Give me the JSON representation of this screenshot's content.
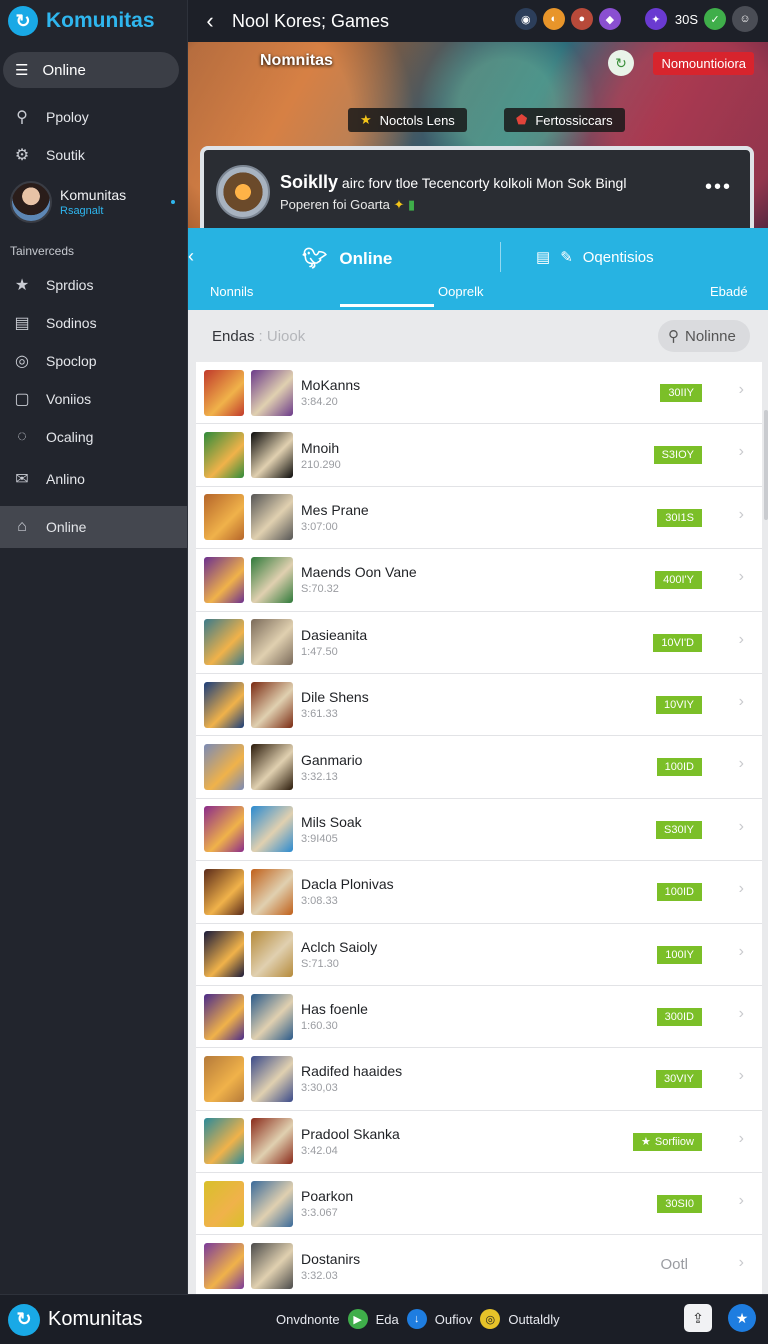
{
  "brand": {
    "name": "Komunitas"
  },
  "sidebar": {
    "online_pill": "Online",
    "items_top": [
      {
        "label": "Ppoloy",
        "icon": "search-icon"
      },
      {
        "label": "Soutik",
        "icon": "gear-icon"
      }
    ],
    "profile": {
      "name": "Komunitas",
      "sub": "Rsagnalt"
    },
    "section_label": "Tainverceds",
    "items": [
      {
        "label": "Sprdios",
        "icon": "star-icon"
      },
      {
        "label": "Sodinos",
        "icon": "list-icon"
      },
      {
        "label": "Spoclop",
        "icon": "gamepad-icon"
      },
      {
        "label": "Voniios",
        "icon": "monitor-icon"
      },
      {
        "label": "Ocaling",
        "icon": "chat-icon"
      },
      {
        "label": "Anlino",
        "icon": "mail-icon"
      },
      {
        "label": "Online",
        "icon": "home-icon"
      }
    ]
  },
  "topbar": {
    "title": "Nool Kores; Games",
    "count": "30S"
  },
  "hero": {
    "title": "Nomnitas",
    "badge": "Nomountioiora",
    "pill_left": "Noctols Lens",
    "pill_right": "Fertossiccars",
    "feature_bold": "Soiklly",
    "feature_line1": " airc forv tloe Tecencorty kolkoli Mon Sok Bingl",
    "feature_line2": "Poperen foi Goarta"
  },
  "tabs": {
    "main_tab": "Online",
    "second_tab": "Oqentisios",
    "sub_left": "Nonnils",
    "sub_active": "Ooprelk",
    "sub_right": "Ebadé"
  },
  "list_header": {
    "label": "Endas",
    "sub": ": Uiook",
    "search": "Nolinne"
  },
  "colors": {
    "accent": "#27b3e2",
    "badge_green": "#7bbf28",
    "hero_badge": "#d8242d"
  },
  "rows": [
    {
      "title": "MoKanns",
      "sub": "3:84.20",
      "badge": "30IIY"
    },
    {
      "title": "Mnoih",
      "sub": "210.290",
      "badge": "S3IOY"
    },
    {
      "title": "Mes Prane",
      "sub": "3:07:00",
      "badge": "30I1S"
    },
    {
      "title": "Maends Oon Vane",
      "sub": "S:70.32",
      "badge": "400I'Y"
    },
    {
      "title": "Dasieanita",
      "sub": "1:47.50",
      "badge": "10VI'D"
    },
    {
      "title": "Dile Shens",
      "sub": "3:61.33",
      "badge": "10VIY"
    },
    {
      "title": "Ganmario",
      "sub": "3:32.13",
      "badge": "100ID"
    },
    {
      "title": "Mils Soak",
      "sub": "3:9I405",
      "badge": "S30IY"
    },
    {
      "title": "Dacla Plonivas",
      "sub": "3:08.33",
      "badge": "100ID"
    },
    {
      "title": "Aclch Saioly",
      "sub": "S:71.30",
      "badge": "100IY"
    },
    {
      "title": "Has foenle",
      "sub": "1:60.30",
      "badge": "300ID"
    },
    {
      "title": "Radifed haaides",
      "sub": "3:30,03",
      "badge": "30VIY"
    },
    {
      "title": "Pradool Skanka",
      "sub": "3:42.04",
      "badge": "Sorfiiow"
    },
    {
      "title": "Poarkon",
      "sub": "3:3.067",
      "badge": "30SI0"
    },
    {
      "title": "Dostanirs",
      "sub": "3:32.03",
      "badge": "Ootl"
    }
  ],
  "bottombar": {
    "brand": "Komunitas",
    "link1": "Onvdnonte",
    "link2": "Eda",
    "link3": "Oufiov",
    "link4": "Outtaldly"
  }
}
